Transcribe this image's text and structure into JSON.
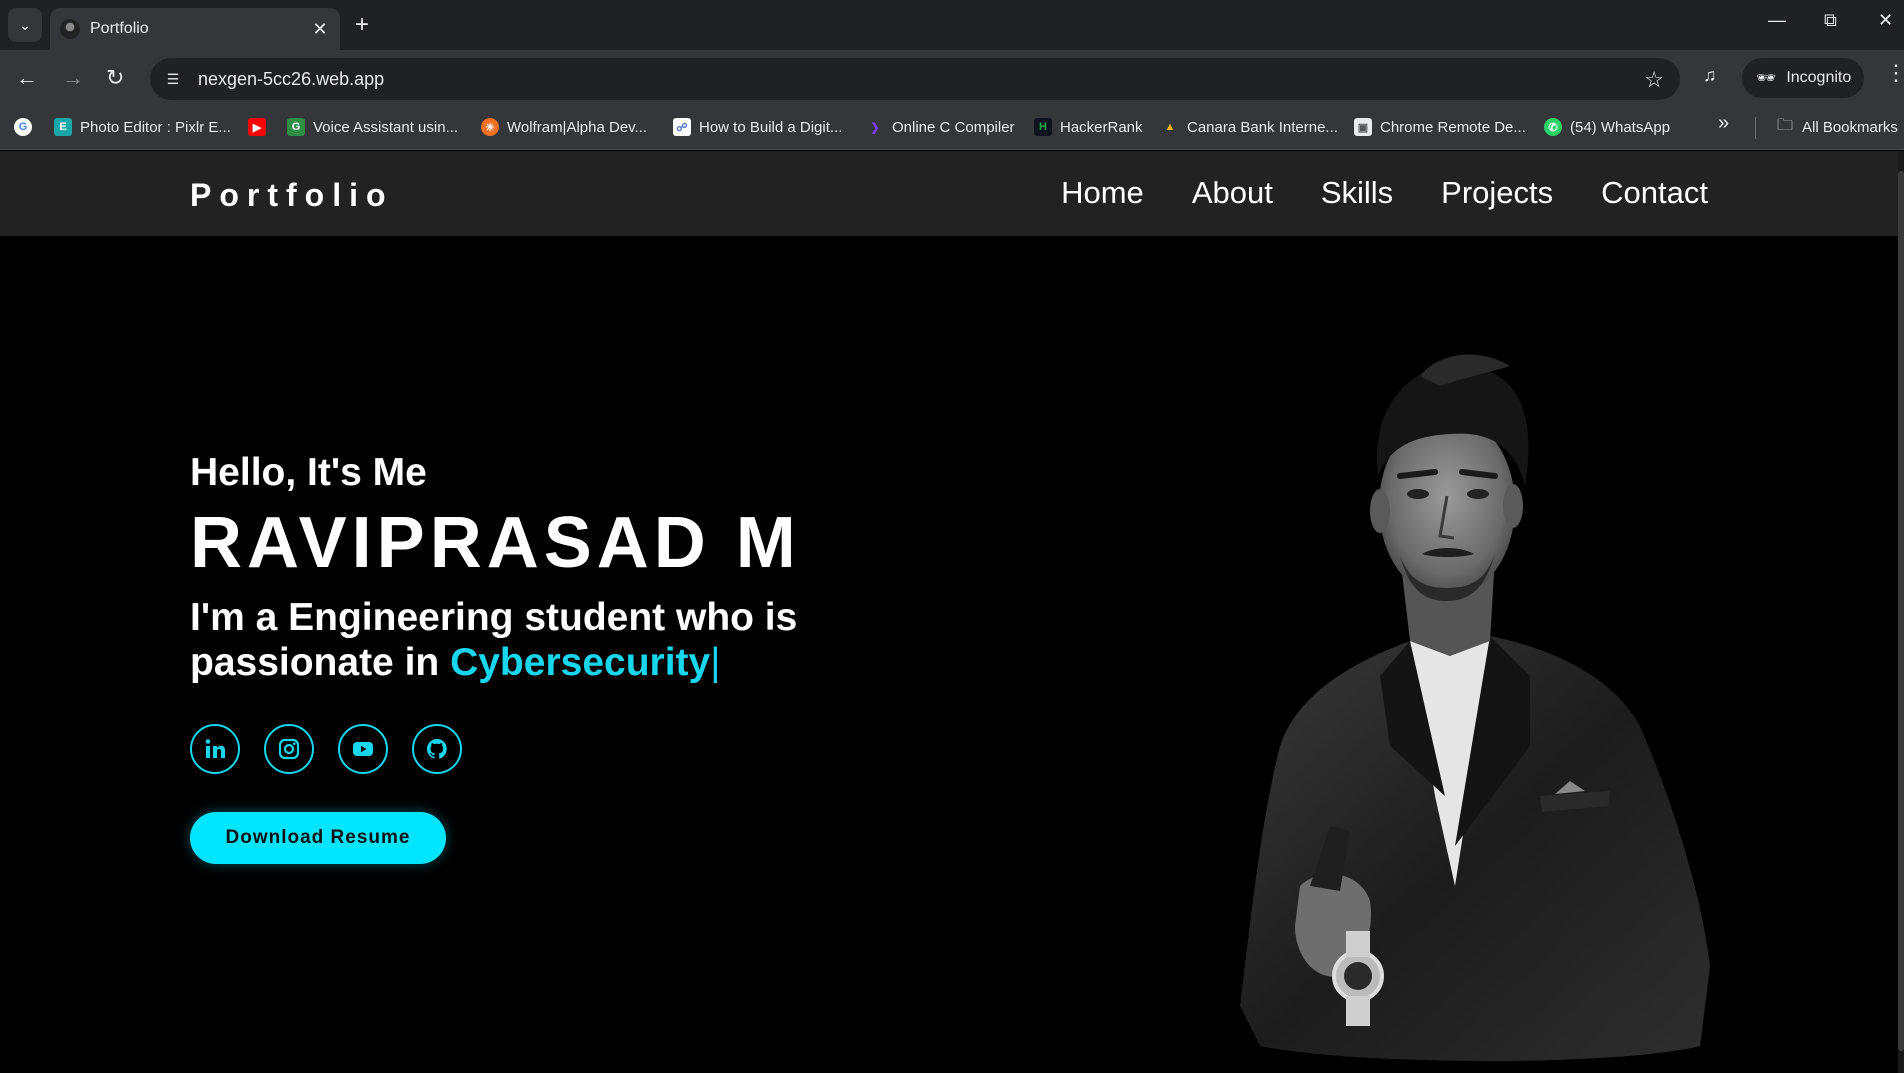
{
  "browser": {
    "tab_title": "Portfolio",
    "url": "nexgen-5cc26.web.app",
    "incognito_label": "Incognito",
    "bookmarks": [
      {
        "label": "Photo Editor : Pixlr E...",
        "icon": "pixlr-icon",
        "color": "#1aa7a7"
      },
      {
        "label": "Voice Assistant usin...",
        "icon": "geeksforgeeks-icon",
        "color": "#2f8d46"
      },
      {
        "label": "Wolfram|Alpha Dev...",
        "icon": "wolfram-icon",
        "color": "#f36f21"
      },
      {
        "label": "How to Build a Digit...",
        "icon": "link-icon",
        "color": "#4a6fd8"
      },
      {
        "label": "Online C Compiler",
        "icon": "compiler-icon",
        "color": "#7b3ff2"
      },
      {
        "label": "HackerRank",
        "icon": "hackerrank-icon",
        "color": "#1ba94c"
      },
      {
        "label": "Canara Bank Interne...",
        "icon": "canara-icon",
        "color": "#f5b800"
      },
      {
        "label": "Chrome Remote De...",
        "icon": "remote-desktop-icon",
        "color": "#e8eaed"
      },
      {
        "label": "(54) WhatsApp",
        "icon": "whatsapp-icon",
        "color": "#25d366"
      }
    ],
    "all_bookmarks_label": "All Bookmarks"
  },
  "site": {
    "logo": "Portfolio",
    "nav": [
      "Home",
      "About",
      "Skills",
      "Projects",
      "Contact"
    ],
    "hero": {
      "greeting": "Hello, It's Me",
      "name": "RAVIPRASAD M",
      "tagline_prefix": "I'm a Engineering student who is passionate in ",
      "tagline_highlight": "Cybersecurity",
      "caret": "|",
      "resume_button": "Download Resume"
    },
    "socials": [
      "linkedin-icon",
      "instagram-icon",
      "youtube-icon",
      "github-icon"
    ],
    "accent_color": "#17d7ee"
  }
}
